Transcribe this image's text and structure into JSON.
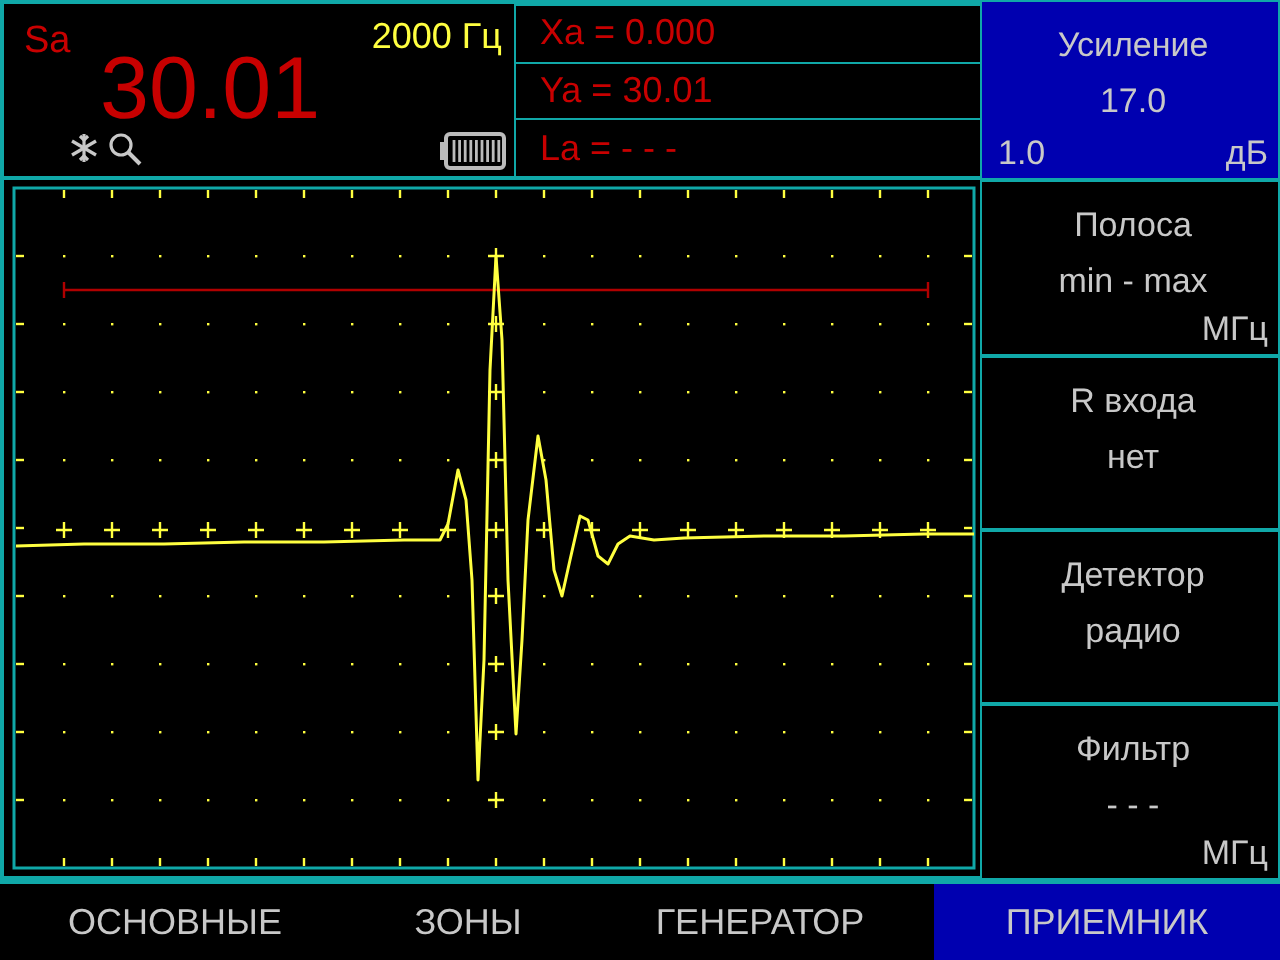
{
  "readout": {
    "label": "Sa",
    "value": "30.01",
    "frequency": "2000 Гц"
  },
  "measurements": [
    "Xa = 0.000",
    "Ya = 30.01",
    "La = - - -"
  ],
  "gain": {
    "title": "Усиление",
    "value": "17.0",
    "step": "1.0",
    "unit": "дБ",
    "selected": true
  },
  "parameters": [
    {
      "title": "Полоса",
      "value": "min - max",
      "unit": "МГц",
      "selected": false
    },
    {
      "title": "R входа",
      "value": "нет",
      "selected": false
    },
    {
      "title": "Детектор",
      "value": "радио",
      "selected": false
    },
    {
      "title": "Фильтр",
      "value": "- - -",
      "unit": "МГц",
      "selected": false
    }
  ],
  "tabs": [
    {
      "label": "ОСНОВНЫЕ",
      "selected": false
    },
    {
      "label": "ЗОНЫ",
      "selected": false
    },
    {
      "label": "ГЕНЕРАТОР",
      "selected": false
    },
    {
      "label": "ПРИЕМНИК",
      "selected": true
    }
  ]
}
